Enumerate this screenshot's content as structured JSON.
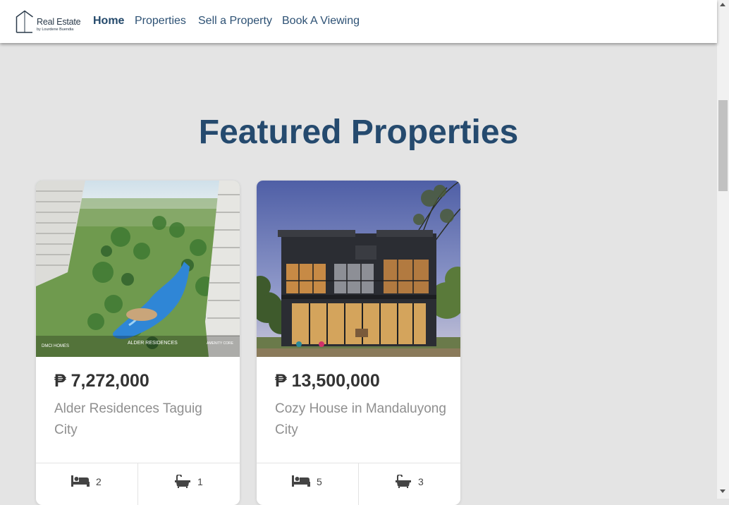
{
  "nav": {
    "logo_text": "Real Estate",
    "logo_subtext": "by Lourdene Buendia",
    "links": [
      {
        "label": "Home",
        "active": true
      },
      {
        "label": "Properties",
        "active": false
      },
      {
        "label": "Sell a Property",
        "active": false
      },
      {
        "label": "Book A Viewing",
        "active": false
      }
    ]
  },
  "main": {
    "heading": "Featured Properties"
  },
  "properties": [
    {
      "price": "₱ 7,272,000",
      "title": "Alder Residences Taguig City",
      "bedrooms": "2",
      "bathrooms": "1",
      "image_watermark_left": "DMCI HOMES",
      "image_watermark_center": "ALDER RESIDENCES",
      "image_watermark_right": "AMENITY CORE"
    },
    {
      "price": "₱ 13,500,000",
      "title": "Cozy House in Mandaluyong City",
      "bedrooms": "5",
      "bathrooms": "3"
    }
  ],
  "icons": {
    "bed": "bed-icon",
    "bath": "bathtub-icon"
  },
  "colors": {
    "primary": "#254a6e",
    "nav_link": "#2d5174",
    "background": "#e4e4e4",
    "price_text": "#333333",
    "title_text": "#8f8f8f"
  }
}
